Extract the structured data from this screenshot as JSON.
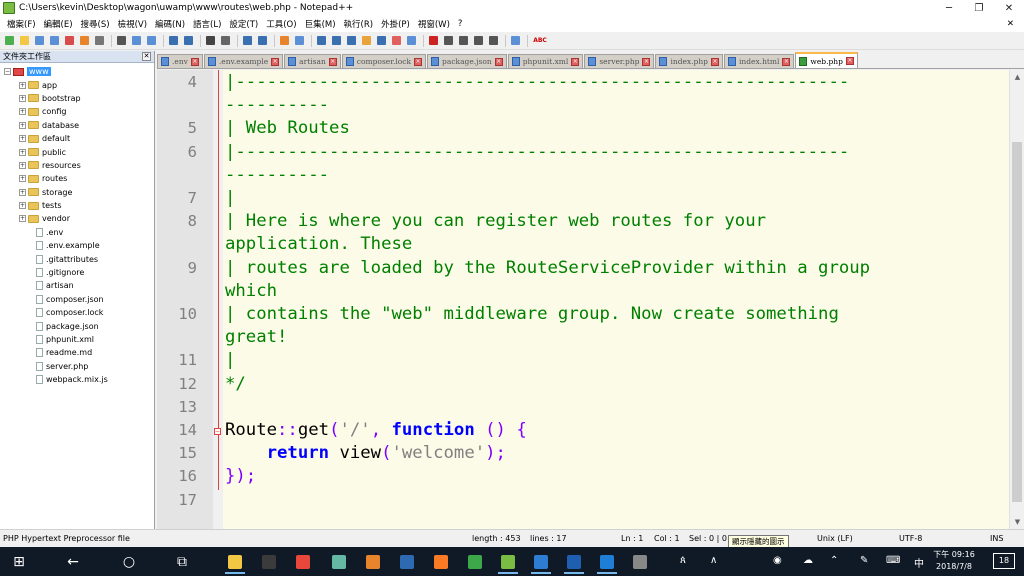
{
  "window": {
    "title": "C:\\Users\\kevin\\Desktop\\wagon\\uwamp\\www\\routes\\web.php - Notepad++",
    "minimize_glyph": "─",
    "maximize_glyph": "❐",
    "close_glyph": "✕"
  },
  "menu": [
    {
      "label": "檔案(F)"
    },
    {
      "label": "編輯(E)"
    },
    {
      "label": "搜尋(S)"
    },
    {
      "label": "檢視(V)"
    },
    {
      "label": "編碼(N)"
    },
    {
      "label": "語言(L)"
    },
    {
      "label": "設定(T)"
    },
    {
      "label": "工具(O)"
    },
    {
      "label": "巨集(M)"
    },
    {
      "label": "執行(R)"
    },
    {
      "label": "外掛(P)"
    },
    {
      "label": "視窗(W)"
    },
    {
      "label": "?"
    }
  ],
  "menu_close_glyph": "✕",
  "toolbar_abc": "ABC",
  "folder_panel": {
    "title": "文件夾工作區",
    "close_glyph": "✕",
    "root": "www",
    "folders": [
      "app",
      "bootstrap",
      "config",
      "database",
      "default",
      "public",
      "resources",
      "routes",
      "storage",
      "tests",
      "vendor"
    ],
    "files": [
      ".env",
      ".env.example",
      ".gitattributes",
      ".gitignore",
      "artisan",
      "composer.json",
      "composer.lock",
      "package.json",
      "phpunit.xml",
      "readme.md",
      "server.php",
      "webpack.mix.js"
    ]
  },
  "tabs": [
    {
      "label": ".env",
      "active": false
    },
    {
      "label": ".env.example",
      "active": false
    },
    {
      "label": "artisan",
      "active": false
    },
    {
      "label": "composer.lock",
      "active": false
    },
    {
      "label": "package.json",
      "active": false
    },
    {
      "label": "phpunit.xml",
      "active": false
    },
    {
      "label": "server.php",
      "active": false
    },
    {
      "label": "index.php",
      "active": false
    },
    {
      "label": "index.html",
      "active": false
    },
    {
      "label": "web.php",
      "active": true
    }
  ],
  "editor": {
    "lines": [
      {
        "num": "4",
        "rows": [
          [
            {
              "t": "|-----------------------------------------------------------",
              "c": "comment"
            }
          ],
          [
            {
              "t": "----------",
              "c": "comment"
            }
          ]
        ]
      },
      {
        "num": "5",
        "rows": [
          [
            {
              "t": "| Web Routes",
              "c": "comment"
            }
          ]
        ]
      },
      {
        "num": "6",
        "rows": [
          [
            {
              "t": "|-----------------------------------------------------------",
              "c": "comment"
            }
          ],
          [
            {
              "t": "----------",
              "c": "comment"
            }
          ]
        ]
      },
      {
        "num": "7",
        "rows": [
          [
            {
              "t": "|",
              "c": "comment"
            }
          ]
        ]
      },
      {
        "num": "8",
        "rows": [
          [
            {
              "t": "| Here is where you can register web routes for your",
              "c": "comment"
            }
          ],
          [
            {
              "t": "application. These",
              "c": "comment"
            }
          ]
        ]
      },
      {
        "num": "9",
        "rows": [
          [
            {
              "t": "| routes are loaded by the RouteServiceProvider within a group",
              "c": "comment"
            }
          ],
          [
            {
              "t": "which",
              "c": "comment"
            }
          ]
        ]
      },
      {
        "num": "10",
        "rows": [
          [
            {
              "t": "| contains the \"web\" middleware group. Now create something",
              "c": "comment"
            }
          ],
          [
            {
              "t": "great!",
              "c": "comment"
            }
          ]
        ]
      },
      {
        "num": "11",
        "rows": [
          [
            {
              "t": "|",
              "c": "comment"
            }
          ]
        ]
      },
      {
        "num": "12",
        "rows": [
          [
            {
              "t": "*/",
              "c": "comment"
            }
          ]
        ]
      },
      {
        "num": "13",
        "rows": [
          [
            {
              "t": "",
              "c": "default"
            }
          ]
        ]
      },
      {
        "num": "14",
        "fold": true,
        "rows": [
          [
            {
              "t": "Route",
              "c": "default"
            },
            {
              "t": "::",
              "c": "op"
            },
            {
              "t": "get",
              "c": "default"
            },
            {
              "t": "(",
              "c": "op"
            },
            {
              "t": "'/'",
              "c": "str"
            },
            {
              "t": ", ",
              "c": "op"
            },
            {
              "t": "function",
              "c": "kw"
            },
            {
              "t": " ",
              "c": "default"
            },
            {
              "t": "()",
              "c": "op"
            },
            {
              "t": " ",
              "c": "default"
            },
            {
              "t": "{",
              "c": "op"
            }
          ]
        ]
      },
      {
        "num": "15",
        "rows": [
          [
            {
              "t": "    ",
              "c": "default"
            },
            {
              "t": "return",
              "c": "kw"
            },
            {
              "t": " view",
              "c": "default"
            },
            {
              "t": "(",
              "c": "op"
            },
            {
              "t": "'welcome'",
              "c": "str"
            },
            {
              "t": ");",
              "c": "op"
            }
          ]
        ]
      },
      {
        "num": "16",
        "rows": [
          [
            {
              "t": "});",
              "c": "op"
            }
          ]
        ]
      },
      {
        "num": "17",
        "rows": [
          [
            {
              "t": "",
              "c": "default"
            }
          ]
        ]
      }
    ]
  },
  "statusbar": {
    "filetype": "PHP Hypertext Preprocessor file",
    "length": "length : 453",
    "lines": "lines : 17",
    "ln": "Ln : 1",
    "col": "Col : 1",
    "sel": "Sel : 0 | 0",
    "tooltip": "顯示隱藏的圖示",
    "eol": "Unix (LF)",
    "encoding": "UTF-8",
    "mode": "INS"
  },
  "taskbar": {
    "start_glyph": "⊞",
    "back_glyph": "←",
    "search_glyph": "○",
    "taskview_glyph": "⧉",
    "apps": [
      {
        "name": "file-explorer",
        "color": "#f2c744"
      },
      {
        "name": "app-2",
        "color": "#3b3b3b"
      },
      {
        "name": "chrome",
        "color": "#e8473b"
      },
      {
        "name": "app-4",
        "color": "#64b8a4"
      },
      {
        "name": "app-5",
        "color": "#e8852c"
      },
      {
        "name": "virtualbox",
        "color": "#2d6ab1"
      },
      {
        "name": "xampp",
        "color": "#fb7a24"
      },
      {
        "name": "app-8",
        "color": "#3da84a"
      },
      {
        "name": "notepad-plus-plus",
        "color": "#7bbd42"
      },
      {
        "name": "app-10",
        "color": "#2d7dd2"
      },
      {
        "name": "uwamp",
        "color": "#1e5fb0"
      },
      {
        "name": "edge",
        "color": "#1f7fd6"
      },
      {
        "name": "app-13",
        "color": "#888888"
      }
    ],
    "ime": "中",
    "time": "下午 09:16",
    "date": "2018/7/8",
    "notif_count": "18",
    "tray_chevron": "∧",
    "tray_people": "ጰ"
  }
}
